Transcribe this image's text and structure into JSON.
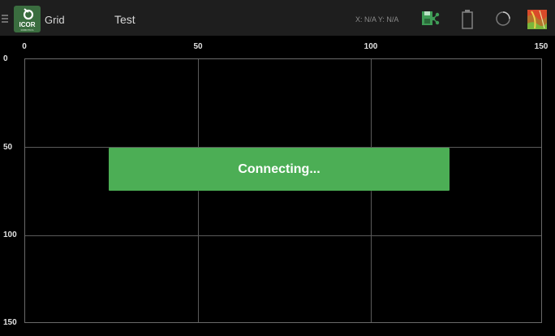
{
  "app": {
    "name": "Grid",
    "logo_text": "ICOR",
    "logo_sub": "ROBOTICS"
  },
  "header": {
    "title": "Test",
    "coords": "X: N/A Y: N/A"
  },
  "icons": {
    "menu": "hamburger-menu-icon",
    "save_share": "save-share-icon",
    "battery": "battery-icon",
    "spinner": "loading-spinner-icon",
    "map": "map-icon"
  },
  "grid": {
    "x_ticks": [
      "0",
      "50",
      "100",
      "150"
    ],
    "y_ticks": [
      "0",
      "50",
      "100",
      "150"
    ],
    "x_range": [
      0,
      150
    ],
    "y_range": [
      0,
      150
    ]
  },
  "status": {
    "message": "Connecting..."
  },
  "colors": {
    "accent_green": "#4cae55",
    "logo_green": "#3a6d3f",
    "background": "#000000"
  }
}
